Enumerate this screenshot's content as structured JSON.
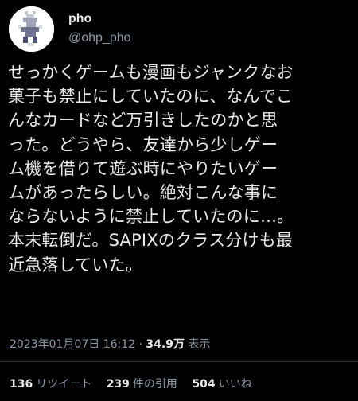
{
  "author": {
    "display_name": "pho",
    "handle": "@ohp_pho",
    "avatar_icon": "pixel-character-avatar-icon"
  },
  "tweet": {
    "lines": [
      "せっかくゲームも漫画もジャンクなお",
      "菓子も禁止にしていたのに、なんでこ",
      "んなカードなど万引きしたのかと思",
      "った。どうやら、友達から少しゲー",
      "ム機を借りて遊ぶ時にやりたいゲー",
      "ムがあったらしい。絶対こんな事に",
      "ならないように禁止していたのに…。",
      "本末転倒だ。SAPIXのクラス分けも最",
      "近急落していた。"
    ]
  },
  "meta": {
    "timestamp": "2023年01月07日 16:12",
    "separator": "·",
    "views_count": "34.9万",
    "views_label": "表示"
  },
  "stats": {
    "retweets_count": "136",
    "retweets_label": "リツイート",
    "quotes_count": "239",
    "quotes_label": "件の引用",
    "likes_count": "504",
    "likes_label": "いいね"
  },
  "colors": {
    "background": "#000000",
    "primary_text": "#e7e9ea",
    "secondary_text": "#8b98a5",
    "divider": "#2f3336"
  }
}
